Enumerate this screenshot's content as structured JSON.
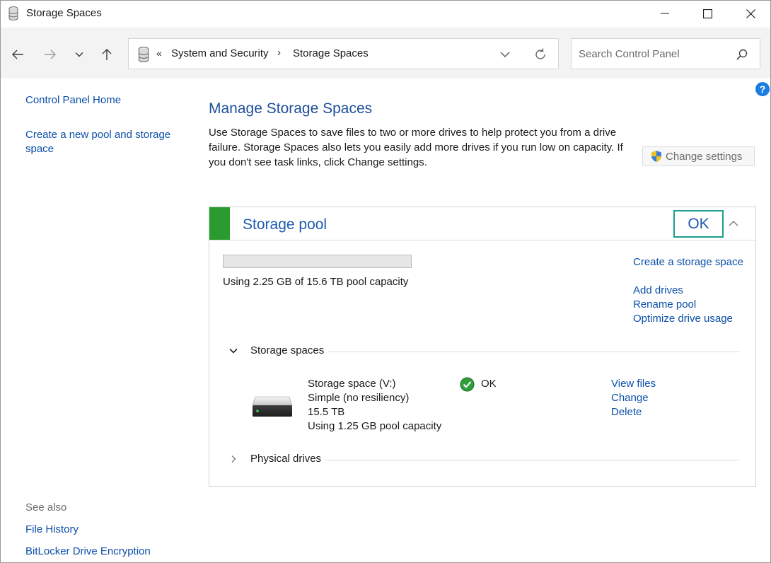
{
  "window": {
    "title": "Storage Spaces",
    "icon": "storage-spaces-icon"
  },
  "address_bar": {
    "overflow_glyph": "«",
    "breadcrumb": [
      "System and Security",
      "Storage Spaces"
    ],
    "separator": "›"
  },
  "search": {
    "placeholder": "Search Control Panel",
    "value": ""
  },
  "help_glyph": "?",
  "sidebar": {
    "home_link": "Control Panel Home",
    "create_link": "Create a new pool and storage space",
    "see_also_label": "See also",
    "see_also_links": [
      "File History",
      "BitLocker Drive Encryption"
    ]
  },
  "main": {
    "heading": "Manage Storage Spaces",
    "description": "Use Storage Spaces to save files to two or more drives to help protect you from a drive failure. Storage Spaces also lets you easily add more drives if you run low on capacity. If you don't see task links, click Change settings.",
    "change_settings_label": "Change settings"
  },
  "pool": {
    "title": "Storage pool",
    "status": "OK",
    "status_color": "#1b9e8d",
    "accent_color": "#2a9b2f",
    "capacity_fraction": 0.0001,
    "capacity_text": "Using 2.25 GB of 15.6 TB pool capacity",
    "links": {
      "create": "Create a storage space",
      "add_drives": "Add drives",
      "rename": "Rename pool",
      "optimize": "Optimize drive usage"
    },
    "storage_spaces_section": "Storage spaces",
    "physical_drives_section": "Physical drives",
    "space": {
      "name": "Storage space (V:)",
      "resiliency": "Simple (no resiliency)",
      "size": "15.5 TB",
      "usage": "Using 1.25 GB pool capacity",
      "status": "OK",
      "links": {
        "view": "View files",
        "change": "Change",
        "delete": "Delete"
      }
    }
  }
}
